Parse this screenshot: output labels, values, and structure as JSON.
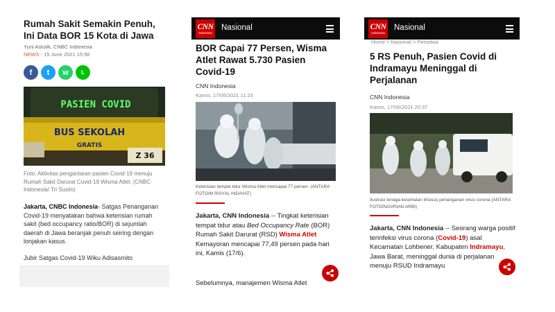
{
  "panel1": {
    "title": "Rumah Sakit Semakin Penuh, Ini Data BOR 15 Kota di Jawa",
    "author": "Yuni Astutik, CNBC Indonesia",
    "meta_news": "NEWS",
    "meta_date": " - 15 June 2021 15:56",
    "share": [
      {
        "icon": "facebook-icon",
        "glyph": "f",
        "color": "#3b5998"
      },
      {
        "icon": "twitter-icon",
        "glyph": "t",
        "color": "#1da1f2"
      },
      {
        "icon": "whatsapp-icon",
        "glyph": "w",
        "color": "#25d366"
      },
      {
        "icon": "line-icon",
        "glyph": "L",
        "color": "#00c300"
      }
    ],
    "photo_sign": "PASIEN COVID",
    "photo_bus_text": "BUS SEKOLAH",
    "photo_gratis": "GRATIS",
    "photo_plate": "Z 36",
    "caption": "Foto: Aktivitas pengantaran pasien Covid-19 menuju Rumah Sakit Darurat Covid-19 Wisma Atlet. (CNBC Indonesia/ Tri Susilo)",
    "lead_bold": "Jakarta, CNBC Indonesia",
    "lead_text": "- Satgas Penanganan Covid-19 menyatakan bahwa keterisian rumah sakit (bed occupancy ratio/BOR) di sejumlah daerah di Jawa beranjak penuh seiring dengan lonjakan kasus.",
    "sign": "Jubir Satgas Covid-19 Wiku Adisasmito"
  },
  "panel2": {
    "logo": "CNN",
    "logo_sub": "Indonesia",
    "section": "Nasional",
    "title": "BOR Capai 77 Persen, Wisma Atlet Rawat 5.730 Pasien Covid-19",
    "source": "CNN Indonesia",
    "date": "Kamis, 17/06/2021 11:23",
    "caption": "Keterisian tempat tidur Wisma Atlet mencapai 77 persen. (ANTARA FOTO/M RISYAL HIDAYAT)",
    "lead_bold": "Jakarta, CNN Indonesia",
    "lead_a": " -- Tingkat keterisian tempat tidur atau ",
    "lead_italic": "Bed Occupancy Rate",
    "lead_b": " (BOR) Rumah Sakit Darurat (RSD) ",
    "lead_link": "Wisma Atlet",
    "lead_c": " Kemayoran mencapai 77,49 persen pada hari ini, Kamis (17/6).",
    "body2": "Sebelumnya, manajemen Wisma Atlet"
  },
  "panel3": {
    "logo": "CNN",
    "logo_sub": "Indonesia",
    "section": "Nasional",
    "breadcrumb": "Home  >  Nasional  >  Peristiwa",
    "title": "5 RS Penuh, Pasien Covid di Indramayu Meninggal di Perjalanan",
    "source": "CNN Indonesia",
    "date": "Kamis, 17/06/2021 20:37",
    "caption": "Ilustrasi tenaga kesehatan khusus penanganan virus corona (ANTARA FOTO/NOVRIAN ARBI)",
    "lead_bold": "Jakarta, CNN Indonesia",
    "lead_a": " -- Seorang warga positif terinfeksi virus corona (",
    "lead_link1": "Covid-19",
    "lead_b": ") asal Kecamatan Lohbener, Kabupaten ",
    "lead_link2": "Indramayu",
    "lead_c": ", Jawa Barat, meninggal dunia di perjalanan menuju RSUD Indramayu"
  }
}
